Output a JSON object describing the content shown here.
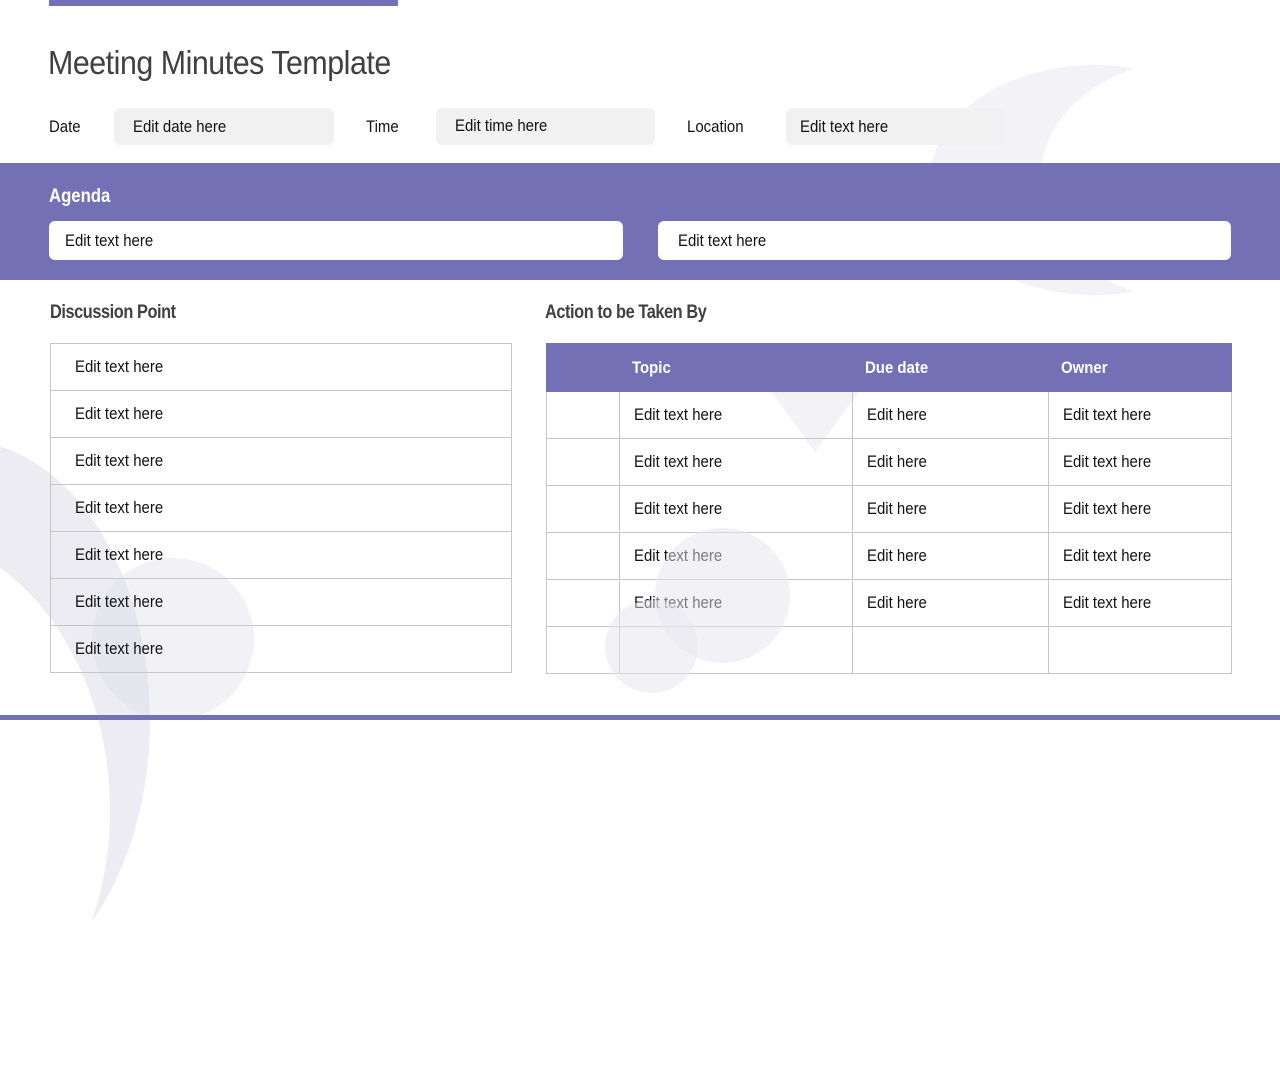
{
  "title": "Meeting Minutes Template",
  "colors": {
    "accent": "#7370b5",
    "field_background": "#f1f1f2",
    "heading_text": "#404040",
    "border": "#c6c6c6"
  },
  "meta": {
    "date": {
      "label": "Date",
      "value": "Edit date here"
    },
    "time": {
      "label": "Time",
      "value": "Edit time here"
    },
    "location": {
      "label": "Location",
      "value": "Edit text here"
    }
  },
  "agenda": {
    "title": "Agenda",
    "items": [
      "Edit text here",
      "Edit text here"
    ]
  },
  "discussion": {
    "title": "Discussion Point",
    "rows": [
      "Edit text here",
      "Edit text here",
      "Edit text here",
      "Edit text here",
      "Edit text here",
      "Edit text here",
      "Edit text here"
    ]
  },
  "actions": {
    "title": "Action to be Taken By",
    "headers": [
      "",
      "Topic",
      "Due date",
      "Owner"
    ],
    "rows": [
      [
        "",
        "Edit text here",
        "Edit here",
        "Edit text here"
      ],
      [
        "",
        "Edit text here",
        "Edit here",
        "Edit text here"
      ],
      [
        "",
        "Edit text here",
        "Edit here",
        "Edit text here"
      ],
      [
        "",
        "Edit text here",
        "Edit here",
        "Edit text here"
      ],
      [
        "",
        "Edit text here",
        "Edit here",
        "Edit text here"
      ],
      [
        "",
        "",
        "",
        ""
      ]
    ]
  }
}
